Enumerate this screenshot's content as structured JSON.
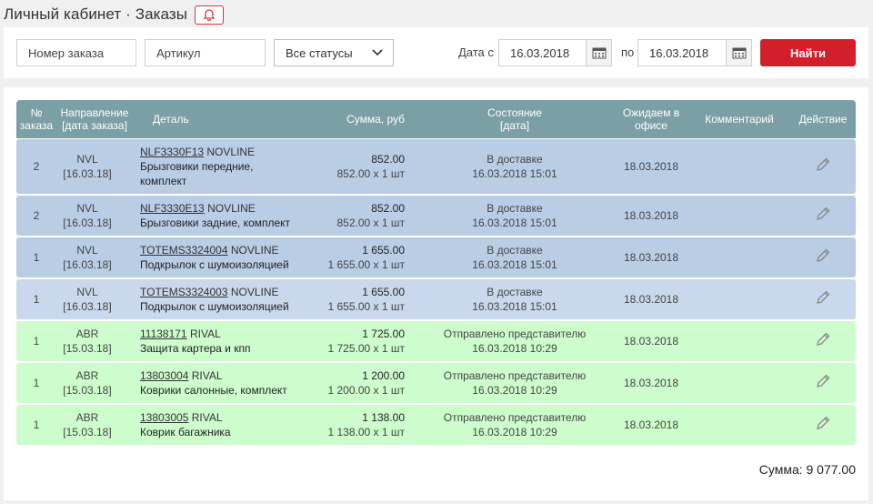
{
  "header": {
    "title": "Личный кабинет · Заказы"
  },
  "filters": {
    "order_number_placeholder": "Номер заказа",
    "article_placeholder": "Артикул",
    "status_selected": "Все статусы",
    "date_from_label": "Дата с",
    "date_from": "16.03.2018",
    "date_to_label": "по",
    "date_to": "16.03.2018",
    "search_button": "Найти"
  },
  "table": {
    "headers": {
      "num": [
        "№",
        "заказа"
      ],
      "direction": [
        "Направление",
        "[дата заказа]"
      ],
      "detail": "Деталь",
      "sum": "Сумма, руб",
      "state": [
        "Состояние",
        "[дата]"
      ],
      "expected": [
        "Ожидаем в",
        "офисе"
      ],
      "comment": "Комментарий",
      "action": "Действие"
    },
    "rows": [
      {
        "num": "2",
        "dir": "NVL",
        "dir_date": "[16.03.18]",
        "article": "NLF3330F13",
        "brand": "NOVLINE",
        "name": "Брызговики передние,",
        "name2": "комплект",
        "total": "852.00",
        "calc": "852.00 x 1 шт",
        "state": "В доставке",
        "state_date": "16.03.2018 15:01",
        "expected": "18.03.2018"
      },
      {
        "num": "2",
        "dir": "NVL",
        "dir_date": "[16.03.18]",
        "article": "NLF3330E13",
        "brand": "NOVLINE",
        "name": "Брызговики задние, комплект",
        "name2": "",
        "total": "852.00",
        "calc": "852.00 x 1 шт",
        "state": "В доставке",
        "state_date": "16.03.2018 15:01",
        "expected": "18.03.2018"
      },
      {
        "num": "1",
        "dir": "NVL",
        "dir_date": "[16.03.18]",
        "article": "TOTEMS3324004",
        "brand": "NOVLINE",
        "name": "Подкрылок с шумоизоляцией",
        "name2": "",
        "total": "1 655.00",
        "calc": "1 655.00 x 1 шт",
        "state": "В доставке",
        "state_date": "16.03.2018 15:01",
        "expected": "18.03.2018"
      },
      {
        "num": "1",
        "dir": "NVL",
        "dir_date": "[16.03.18]",
        "article": "TOTEMS3324003",
        "brand": "NOVLINE",
        "name": "Подкрылок с шумоизоляцией",
        "name2": "",
        "total": "1 655.00",
        "calc": "1 655.00 x 1 шт",
        "state": "В доставке",
        "state_date": "16.03.2018 15:01",
        "expected": "18.03.2018"
      },
      {
        "num": "1",
        "dir": "ABR",
        "dir_date": "[15.03.18]",
        "article": "11138171",
        "brand": "RIVAL",
        "name": "Защита картера и кпп",
        "name2": "",
        "total": "1 725.00",
        "calc": "1 725.00 x 1 шт",
        "state": "Отправлено представителю",
        "state_date": "16.03.2018 10:29",
        "expected": "18.03.2018"
      },
      {
        "num": "1",
        "dir": "ABR",
        "dir_date": "[15.03.18]",
        "article": "13803004",
        "brand": "RIVAL",
        "name": "Коврики салонные, комплект",
        "name2": "",
        "total": "1 200.00",
        "calc": "1 200.00 x 1 шт",
        "state": "Отправлено представителю",
        "state_date": "16.03.2018 10:29",
        "expected": "18.03.2018"
      },
      {
        "num": "1",
        "dir": "ABR",
        "dir_date": "[15.03.18]",
        "article": "13803005",
        "brand": "RIVAL",
        "name": "Коврик багажника",
        "name2": "",
        "total": "1 138.00",
        "calc": "1 138.00 x 1 шт",
        "state": "Отправлено представителю",
        "state_date": "16.03.2018 10:29",
        "expected": "18.03.2018"
      }
    ]
  },
  "total": "Сумма: 9 077.00",
  "colors": {
    "accent": "#d41f2b",
    "header": "#7a9fa4",
    "row_delivery": "#b9cde5",
    "row_sent": "#cdfdcc"
  },
  "icons": {
    "bell": "bell-icon",
    "calendar": "calendar-icon",
    "edit": "pencil-icon",
    "dropdown": "chevron-down-icon"
  }
}
